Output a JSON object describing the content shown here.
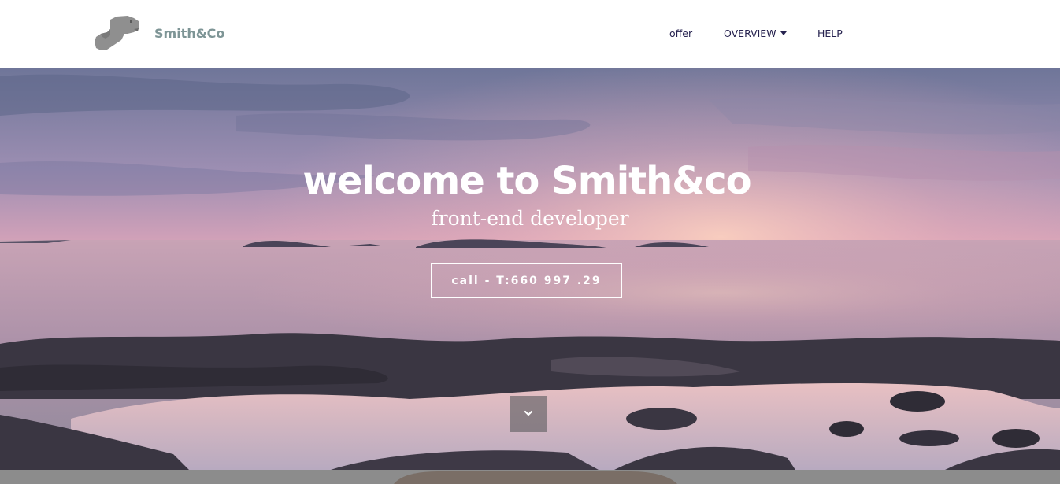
{
  "header": {
    "brand_name": "Smith&Co",
    "logo_icon": "beaver-logo",
    "nav": [
      {
        "label": "offer"
      },
      {
        "label": "OVERVIEW",
        "icon": "caret-down-icon"
      },
      {
        "label": "HELP"
      }
    ]
  },
  "hero": {
    "title": "welcome to Smith&co",
    "subtitle": "front-end developer",
    "cta_label": "call - T:660 997 .29",
    "scroll_icon": "chevron-down-icon"
  },
  "colors": {
    "brand": "#7e9596",
    "nav_text": "#26224f",
    "scroll_button": "#6e696e",
    "bottom_strip": "#8c8c8c"
  }
}
